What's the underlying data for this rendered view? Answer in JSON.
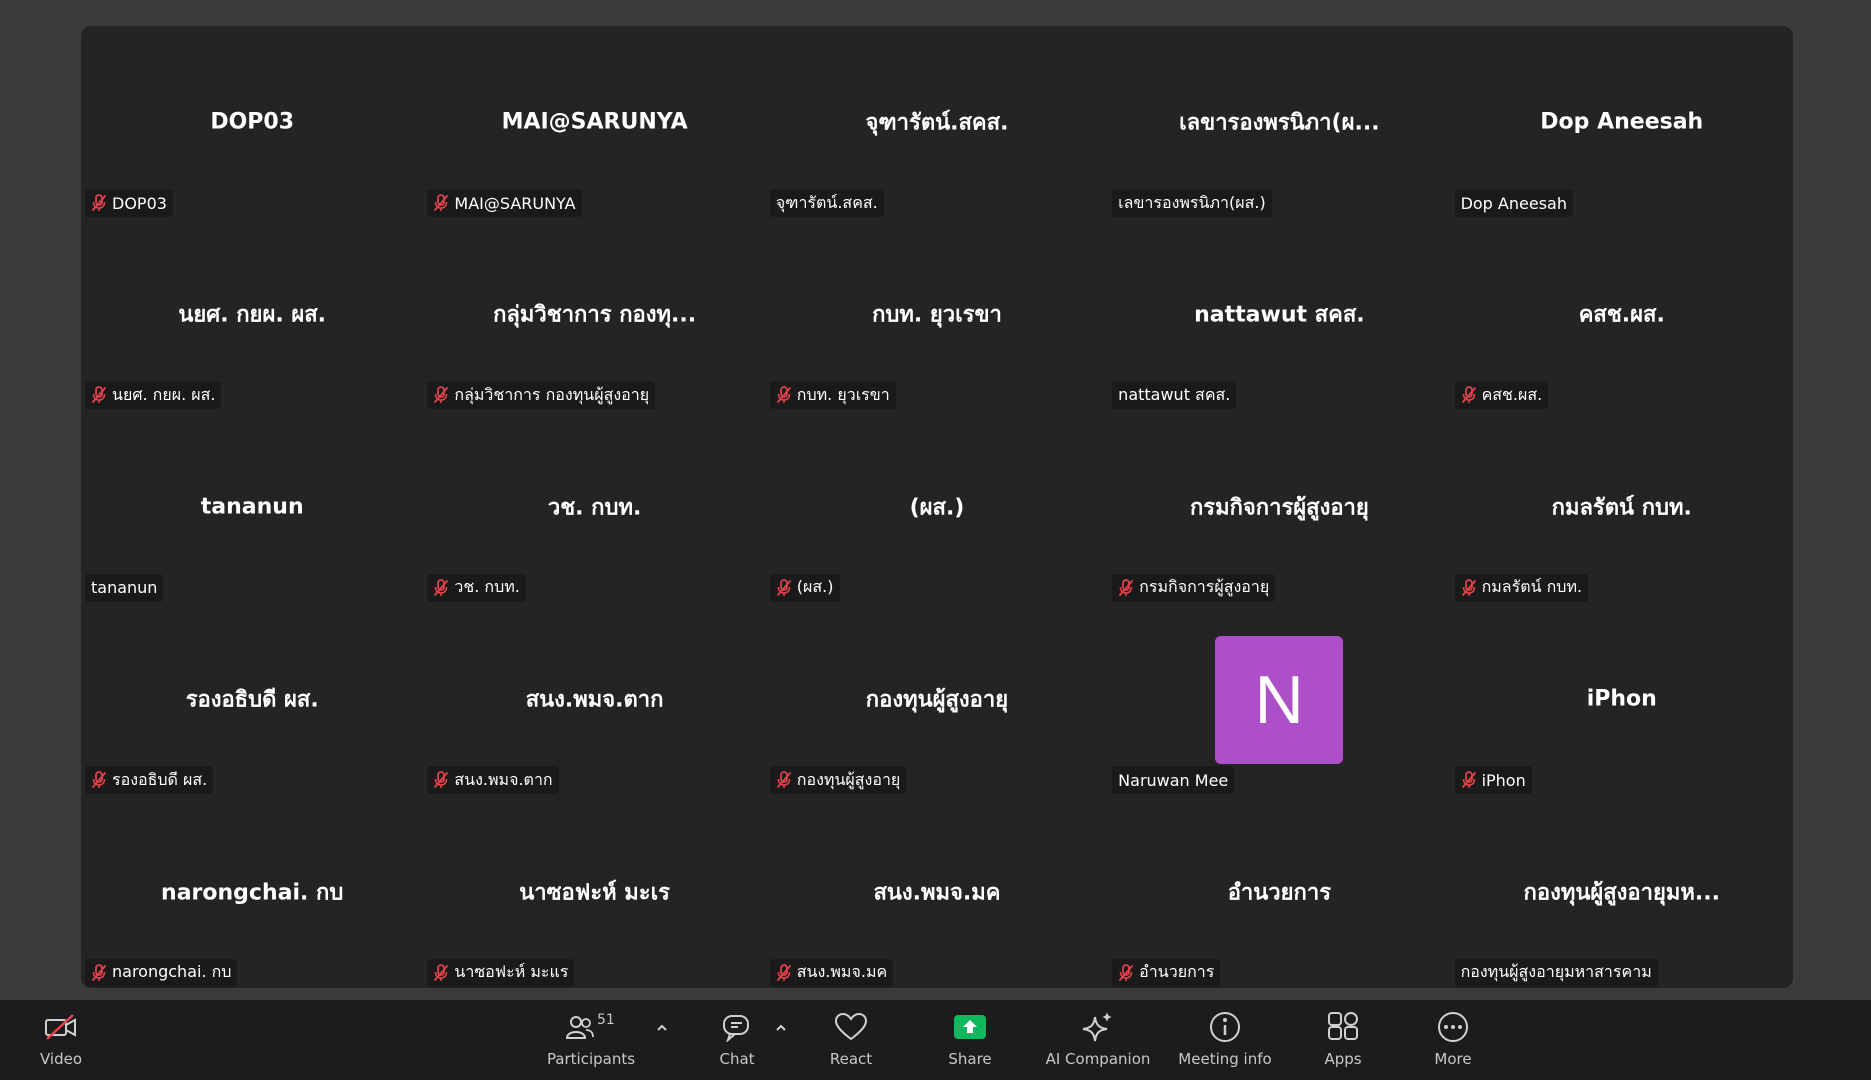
{
  "tiles": [
    {
      "name": "DOP03",
      "label": "DOP03",
      "muted": true
    },
    {
      "name": "MAI@SARUNYA",
      "label": "MAI@SARUNYA",
      "muted": true
    },
    {
      "name": "จุฑารัตน์.สคส.",
      "label": "จุฑารัตน์.สคส.",
      "muted": false
    },
    {
      "name": "เลขารองพรนิภา(ผ...",
      "label": "เลขารองพรนิภา(ผส.)",
      "muted": false
    },
    {
      "name": "Dop Aneesah",
      "label": "Dop Aneesah",
      "muted": false
    },
    {
      "name": "นยศ. กยผ. ผส.",
      "label": "นยศ. กยผ. ผส.",
      "muted": true
    },
    {
      "name": "กลุ่มวิชาการ กองทุ...",
      "label": "กลุ่มวิชาการ กองทุนผู้สูงอายุ",
      "muted": true
    },
    {
      "name": "กบท. ยุวเรขา",
      "label": "กบท. ยุวเรขา",
      "muted": true
    },
    {
      "name": "nattawut สคส.",
      "label": "nattawut สคส.",
      "muted": false
    },
    {
      "name": "คสช.ผส.",
      "label": "คสช.ผส.",
      "muted": true
    },
    {
      "name": "tananun",
      "label": "tananun",
      "muted": false
    },
    {
      "name": "วช. กบท.",
      "label": "วช. กบท.",
      "muted": true
    },
    {
      "name": "(ผส.)",
      "label": "(ผส.)",
      "muted": true
    },
    {
      "name": "กรมกิจการผู้สูงอายุ",
      "label": "กรมกิจการผู้สูงอายุ",
      "muted": true
    },
    {
      "name": "กมลรัตน์ กบท.",
      "label": "กมลรัตน์ กบท.",
      "muted": true
    },
    {
      "name": "รองอธิบดี ผส.",
      "label": "รองอธิบดี ผส.",
      "muted": true
    },
    {
      "name": "สนง.พมจ.ตาก",
      "label": "สนง.พมจ.ตาก",
      "muted": true
    },
    {
      "name": "กองทุนผู้สูงอายุ",
      "label": "กองทุนผู้สูงอายุ",
      "muted": true
    },
    {
      "name": "",
      "avatar_letter": "N",
      "avatar_color": "#ae4fca",
      "label": "Naruwan Mee",
      "muted": false
    },
    {
      "name": "iPhon",
      "label": "iPhon",
      "muted": true
    },
    {
      "name": "narongchai. กบ",
      "label": "narongchai. กบ",
      "muted": true
    },
    {
      "name": "นาซอฟะห์ มะเร",
      "label": "นาซอฟะห์ มะแร",
      "muted": true
    },
    {
      "name": "สนง.พมจ.มค",
      "label": "สนง.พมจ.มค",
      "muted": true
    },
    {
      "name": "อำนวยการ",
      "label": "อำนวยการ",
      "muted": true
    },
    {
      "name": "กองทุนผู้สูงอายุมห...",
      "label": "กองทุนผู้สูงอายุมหาสารคาม",
      "muted": false
    }
  ],
  "toolbar": {
    "video": {
      "label": "Video",
      "icon": "video-off-icon"
    },
    "participants": {
      "label": "Participants",
      "count": "51",
      "icon": "participants-icon"
    },
    "chat": {
      "label": "Chat",
      "icon": "chat-icon"
    },
    "react": {
      "label": "React",
      "icon": "heart-icon"
    },
    "share": {
      "label": "Share",
      "icon": "share-screen-icon",
      "color": "#0fb85c"
    },
    "ai_companion": {
      "label": "AI Companion",
      "icon": "sparkle-icon"
    },
    "meeting_info": {
      "label": "Meeting info",
      "icon": "info-icon"
    },
    "apps": {
      "label": "Apps",
      "icon": "apps-icon"
    },
    "more": {
      "label": "More",
      "icon": "more-icon"
    }
  },
  "colors": {
    "background": "#3b3b3b",
    "stage": "#242424",
    "toolbar": "#1c1c1c",
    "muted_mic": "#e0434b"
  }
}
